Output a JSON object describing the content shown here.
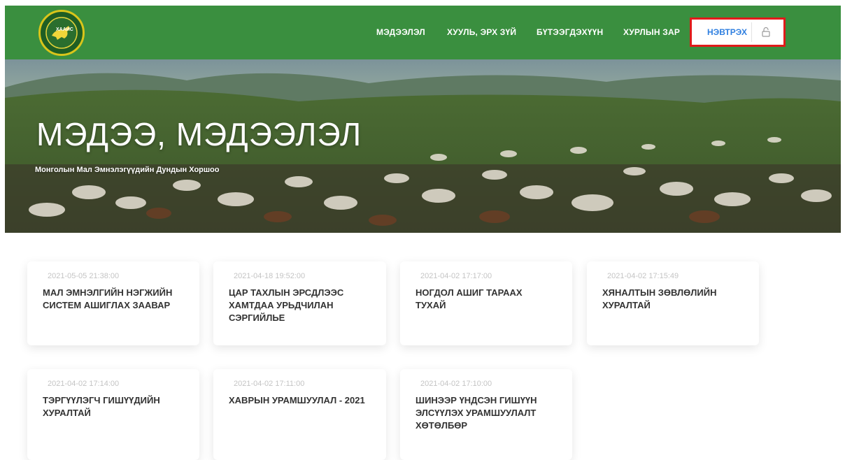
{
  "nav": {
    "logo_text": "ХААИС",
    "items": [
      {
        "label": "МЭДЭЭЛЭЛ"
      },
      {
        "label": "ХУУЛЬ, ЭРХ ЗҮЙ"
      },
      {
        "label": "БҮТЭЭГДЭХҮҮН"
      },
      {
        "label": "ХУРЛЫН ЗАР"
      }
    ],
    "login_label": "НЭВТРЭХ",
    "lock_icon": "lock-icon"
  },
  "hero": {
    "title": "МЭДЭЭ, МЭДЭЭЛЭЛ",
    "subtitle": "Монголын Мал Эмнэлэгүүдийн Дундын Хоршоо"
  },
  "news": [
    {
      "date": "2021-05-05 21:38:00",
      "title": "МАЛ ЭМНЭЛГИЙН НЭГЖИЙН СИСТЕМ АШИГЛАХ ЗААВАР"
    },
    {
      "date": "2021-04-18 19:52:00",
      "title": "ЦАР ТАХЛЫН ЭРСДЛЭЭС ХАМТДАА УРЬДЧИЛАН СЭРГИЙЛЬЕ"
    },
    {
      "date": "2021-04-02 17:17:00",
      "title": "НОГДОЛ АШИГ ТАРААХ ТУХАЙ"
    },
    {
      "date": "2021-04-02 17:15:49",
      "title": "ХЯНАЛТЫН ЗӨВЛӨЛИЙН ХУРАЛТАЙ"
    },
    {
      "date": "2021-04-02 17:14:00",
      "title": "ТЭРГҮҮЛЭГЧ ГИШҮҮДИЙН ХУРАЛТАЙ"
    },
    {
      "date": "2021-04-02 17:11:00",
      "title": "ХАВРЫН УРАМШУУЛАЛ - 2021"
    },
    {
      "date": "2021-04-02 17:10:00",
      "title": "ШИНЭЭР ҮНДСЭН ГИШҮҮН ЭЛСҮҮЛЭХ УРАМШУУЛАЛТ ХӨТӨЛБӨР"
    }
  ],
  "colors": {
    "nav_bg": "#3a8f3f",
    "login_text": "#2f7fe0",
    "highlight": "#e01a1a"
  }
}
